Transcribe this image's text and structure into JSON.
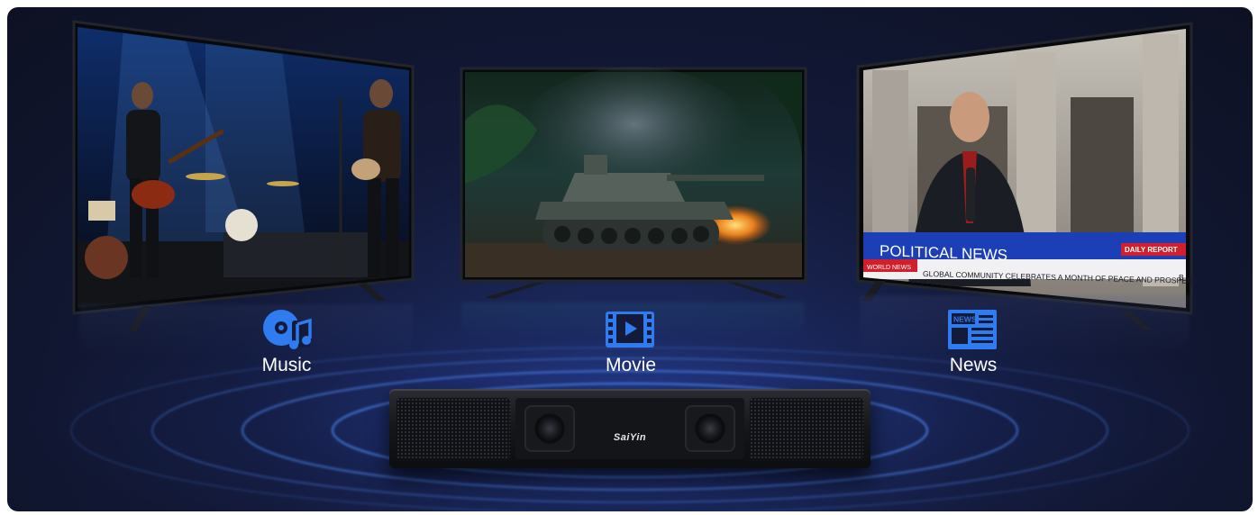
{
  "categories": [
    {
      "label": "Music",
      "icon": "music-note-icon"
    },
    {
      "label": "Movie",
      "icon": "film-play-icon"
    },
    {
      "label": "News",
      "icon": "newspaper-icon"
    }
  ],
  "news_screen": {
    "headline": "POLITICAL NEWS",
    "tag": "DAILY REPORT",
    "ticker_label": "WORLD NEWS",
    "ticker_text": "GLOBAL COMMUNITY CELEBRATES A MONTH OF PEACE AND PROSPERITY",
    "ticker_tail": "B",
    "icon_badge": "NEWS"
  },
  "soundbar": {
    "brand": "SaiYin"
  },
  "colors": {
    "accent": "#2f7bf0",
    "background": "#131a3a",
    "news_blue": "#1c3fb8",
    "news_red": "#d11f2b"
  }
}
